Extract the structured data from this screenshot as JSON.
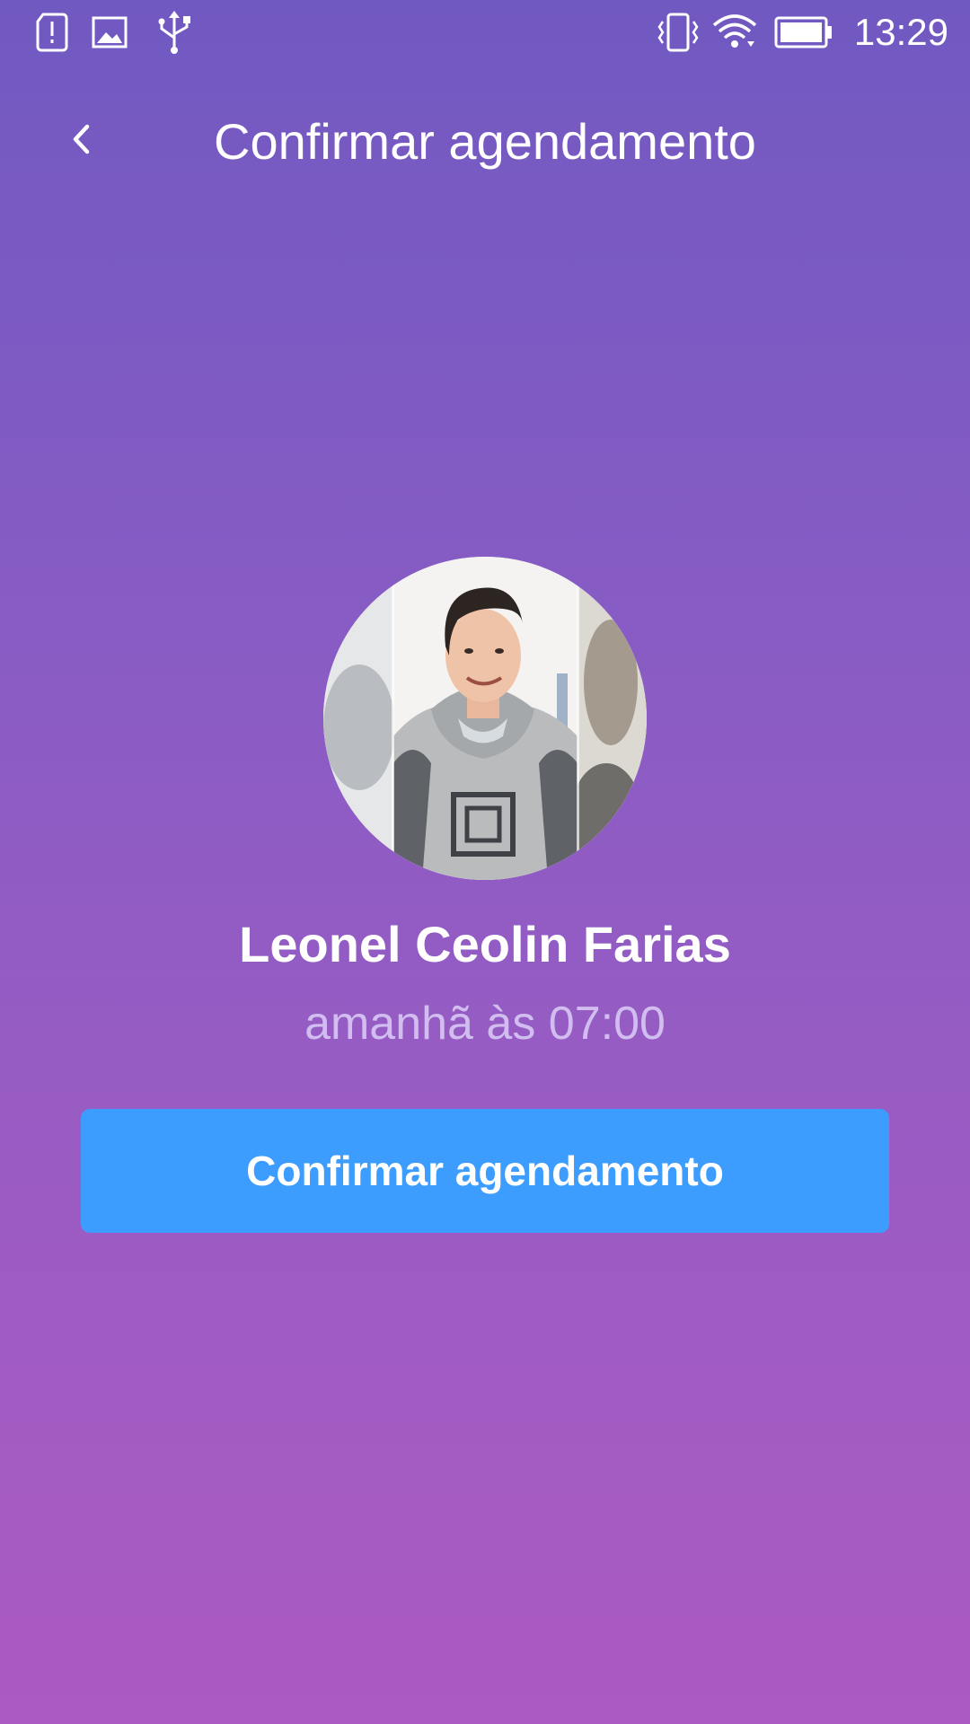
{
  "status_bar": {
    "time": "13:29",
    "icons": [
      "sim-alert-icon",
      "image-icon",
      "usb-icon",
      "vibrate-icon",
      "wifi-icon",
      "battery-icon"
    ]
  },
  "header": {
    "back_icon": "chevron-left-icon",
    "title": "Confirmar agendamento"
  },
  "profile": {
    "name": "Leonel Ceolin Farias",
    "time": "amanhã às 07:00"
  },
  "actions": {
    "confirm_label": "Confirmar agendamento"
  },
  "colors": {
    "gradient_top": "#7159C2",
    "gradient_bottom": "#AA5AC2",
    "button": "#3D9DFE",
    "subtitle": "#D2BDF0"
  }
}
